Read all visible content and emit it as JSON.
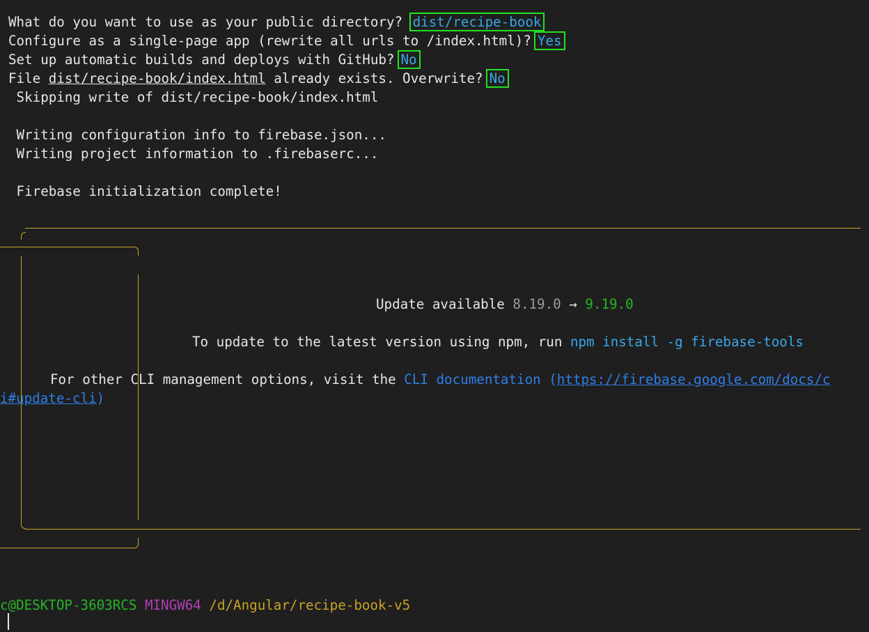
{
  "prompts": {
    "public_dir": {
      "q": "What do you want to use as your public directory?",
      "a": "dist/recipe-book"
    },
    "spa": {
      "q": "Configure as a single-page app (rewrite all urls to /index.html)?",
      "a": "Yes"
    },
    "github": {
      "q": "Set up automatic builds and deploys with GitHub?",
      "a": "No"
    },
    "overwrite": {
      "pre": "File ",
      "file": "dist/recipe-book/index.html",
      "post": " already exists. Overwrite?",
      "a": "No"
    }
  },
  "output": {
    "skip": " Skipping write of dist/recipe-book/index.html",
    "write_config": " Writing configuration info to firebase.json...",
    "write_project": " Writing project information to .firebaserc...",
    "complete": " Firebase initialization complete!"
  },
  "update_box": {
    "label": "Update available ",
    "old_version": "8.19.0",
    "arrow": " → ",
    "new_version": "9.19.0",
    "npm_text": "To update to the latest version using npm, run ",
    "npm_cmd": "npm install -g firebase-tools",
    "other_text": "For other CLI management options, visit the ",
    "doc_label": "CLI documentation",
    "paren_open": " (",
    "url_part1": "https://firebase.google.com/docs/c",
    "url_part2": "i#update-cli",
    "paren_close": ")"
  },
  "prompt_line": {
    "user_host": "c@DESKTOP-3603RCS",
    "env": "MINGW64",
    "path": "/d/Angular/recipe-book-v5"
  },
  "colors": {
    "background": "#1f1f1f",
    "answer": "#3aa7e6",
    "highlight": "#22e022",
    "box_border": "#c9a227",
    "user_host": "#25b525",
    "env": "#b43fb4"
  }
}
